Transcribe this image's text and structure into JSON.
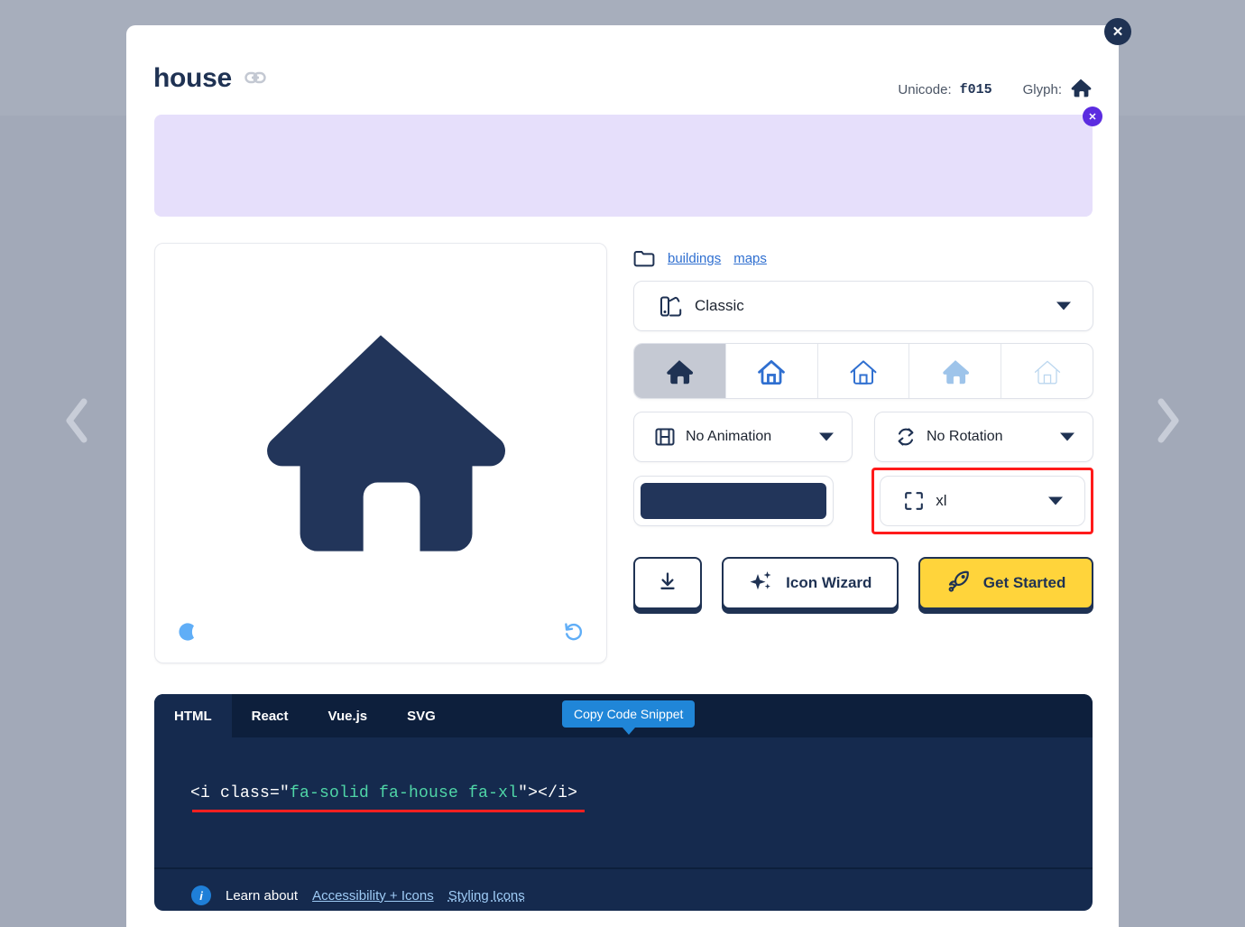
{
  "header": {
    "title": "house",
    "link_icon": "link-icon",
    "unicode_label": "Unicode:",
    "unicode_value": "f015",
    "glyph_label": "Glyph:",
    "glyph_icon": "house-icon"
  },
  "close_buttons": {
    "modal_close": "✕",
    "banner_close": "✕"
  },
  "navigation": {
    "prev": "chevron-left-icon",
    "next": "chevron-right-icon"
  },
  "preview": {
    "icon_name": "house-icon",
    "icon_color": "#22355a",
    "dark_mode_icon": "moon-icon",
    "reset_icon": "rotate-left-icon",
    "control_color": "#60aef7"
  },
  "categories": {
    "folder_icon": "folder-icon",
    "items": [
      {
        "label": "buildings"
      },
      {
        "label": "maps"
      }
    ]
  },
  "style_select": {
    "icon": "palette-icon",
    "value": "Classic",
    "caret": "chevron-down-icon"
  },
  "style_variants": [
    {
      "name": "solid",
      "selected": true
    },
    {
      "name": "regular",
      "selected": false
    },
    {
      "name": "light",
      "selected": false
    },
    {
      "name": "duotone",
      "selected": false
    },
    {
      "name": "thin",
      "selected": false
    }
  ],
  "animation_select": {
    "icon": "film-icon",
    "value": "No Animation",
    "caret": "chevron-down-icon"
  },
  "rotation_select": {
    "icon": "rotate-icon",
    "value": "No Rotation",
    "caret": "chevron-down-icon"
  },
  "color_swatch": {
    "name": "color-swatch",
    "color": "#22355a"
  },
  "size_select": {
    "icon": "expand-icon",
    "value": "xl",
    "caret": "chevron-down-icon",
    "highlight_color": "#ff1a1a"
  },
  "actions": {
    "download_icon": "download-icon",
    "wizard_icon": "sparkles-icon",
    "wizard_label": "Icon Wizard",
    "get_started_icon": "rocket-icon",
    "get_started_label": "Get Started",
    "get_started_color": "#ffd43b"
  },
  "code_panel": {
    "tabs": [
      {
        "label": "HTML",
        "active": true
      },
      {
        "label": "React",
        "active": false
      },
      {
        "label": "Vue.js",
        "active": false
      },
      {
        "label": "SVG",
        "active": false
      }
    ],
    "copy_label": "Copy Code Snippet",
    "snippet": {
      "prefix": "<i class=\"",
      "classes": "fa-solid fa-house fa-xl",
      "suffix": "\"></i>"
    },
    "footer": {
      "info_icon": "info-icon",
      "text": "Learn about",
      "links": [
        {
          "label": "Accessibility + Icons"
        },
        {
          "label": "Styling Icons"
        }
      ]
    }
  }
}
